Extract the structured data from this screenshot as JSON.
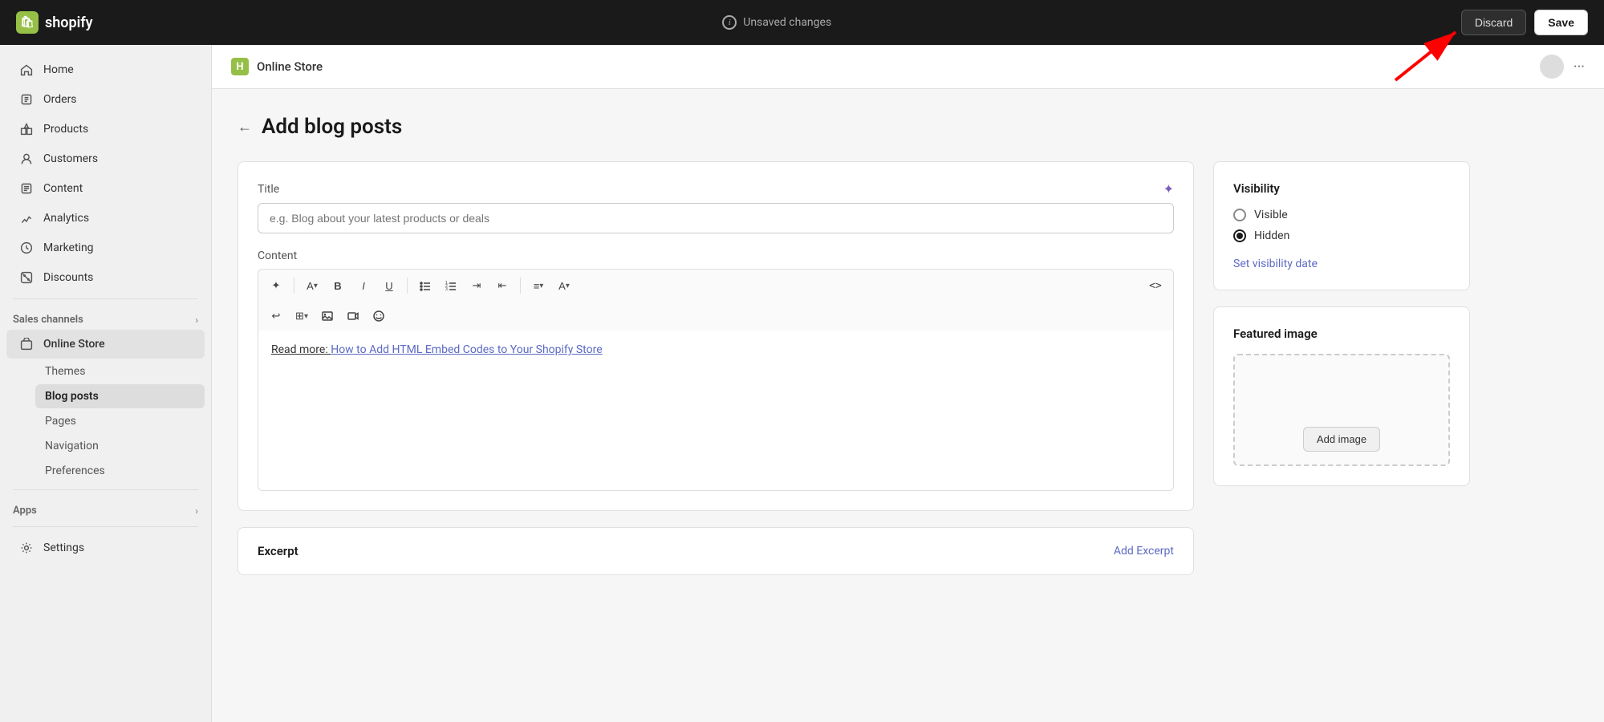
{
  "topbar": {
    "logo_text": "shopify",
    "unsaved_label": "Unsaved changes",
    "discard_label": "Discard",
    "save_label": "Save"
  },
  "sidebar": {
    "nav_items": [
      {
        "id": "home",
        "label": "Home",
        "icon": "home"
      },
      {
        "id": "orders",
        "label": "Orders",
        "icon": "orders"
      },
      {
        "id": "products",
        "label": "Products",
        "icon": "products"
      },
      {
        "id": "customers",
        "label": "Customers",
        "icon": "customers"
      },
      {
        "id": "content",
        "label": "Content",
        "icon": "content"
      },
      {
        "id": "analytics",
        "label": "Analytics",
        "icon": "analytics"
      },
      {
        "id": "marketing",
        "label": "Marketing",
        "icon": "marketing"
      },
      {
        "id": "discounts",
        "label": "Discounts",
        "icon": "discounts"
      }
    ],
    "sales_channels_label": "Sales channels",
    "online_store_label": "Online Store",
    "sub_items": [
      {
        "id": "themes",
        "label": "Themes"
      },
      {
        "id": "blog-posts",
        "label": "Blog posts",
        "active": true
      },
      {
        "id": "pages",
        "label": "Pages"
      },
      {
        "id": "navigation",
        "label": "Navigation"
      },
      {
        "id": "preferences",
        "label": "Preferences"
      }
    ],
    "apps_label": "Apps",
    "settings_label": "Settings"
  },
  "store_header": {
    "store_name": "Online Store"
  },
  "page": {
    "back_label": "←",
    "title": "Add blog posts"
  },
  "editor": {
    "title_label": "Title",
    "title_placeholder": "e.g. Blog about your latest products or deals",
    "content_label": "Content",
    "content_text_prefix": "Read more: ",
    "content_link_text": "How to Add HTML Embed Codes to Your Shopify Store",
    "toolbar_buttons": [
      "✦",
      "A",
      "B",
      "I",
      "U",
      "≡",
      "≡",
      "≡",
      "≡",
      "≡",
      "A",
      "<>"
    ],
    "toolbar2_buttons": [
      "↩",
      "⊞",
      "🖼",
      "📹",
      "⊘"
    ]
  },
  "visibility": {
    "title": "Visibility",
    "options": [
      {
        "id": "visible",
        "label": "Visible",
        "checked": false
      },
      {
        "id": "hidden",
        "label": "Hidden",
        "checked": true
      }
    ],
    "set_date_label": "Set visibility date"
  },
  "featured_image": {
    "title": "Featured image",
    "add_image_label": "Add image"
  },
  "excerpt": {
    "title": "Excerpt",
    "add_label": "Add Excerpt"
  }
}
